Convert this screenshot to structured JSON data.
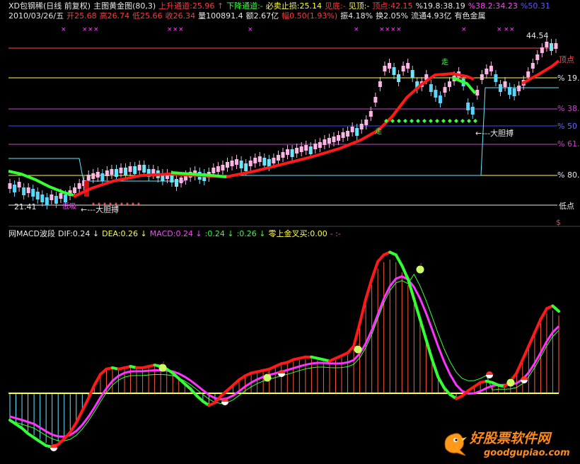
{
  "header": {
    "line1": [
      {
        "text": "XD包钢稀(日线 前复权)",
        "color": "#e8e8e8"
      },
      {
        "text": "主图黄金图(80,3)",
        "color": "#e8e8e8"
      },
      {
        "text": "上升通道:25.96 ↑",
        "color": "#ff3a3a"
      },
      {
        "text": "下降通道:-",
        "color": "#3aff3a"
      },
      {
        "text": "必卖止损:25.14",
        "color": "#ffff44"
      },
      {
        "text": "见底:-",
        "color": "#ff3a3a"
      },
      {
        "text": "见顶:-",
        "color": "#ffff44"
      },
      {
        "text": "顶点:42.15",
        "color": "#ff3a3a"
      },
      {
        "text": "%19.8:38.19",
        "color": "#e8e8e8"
      },
      {
        "text": "%38.2:34.23",
        "color": "#ff44ff"
      },
      {
        "text": "%50.31",
        "color": "#5a5aff"
      }
    ],
    "line2": [
      {
        "text": "2010/03/26/五",
        "color": "#e8e8e8"
      },
      {
        "text": "开25.68",
        "color": "#ff3a3a"
      },
      {
        "text": "高26.74",
        "color": "#ff3a3a"
      },
      {
        "text": "低25.66",
        "color": "#ff3a3a"
      },
      {
        "text": "收26.34",
        "color": "#ff3a3a"
      },
      {
        "text": "量100891.4",
        "color": "#e8e8e8"
      },
      {
        "text": "额2.67亿",
        "color": "#e8e8e8"
      },
      {
        "text": "幅0.50(1.93%)",
        "color": "#ff3a3a"
      },
      {
        "text": "振4.18%",
        "color": "#e8e8e8"
      },
      {
        "text": "换2.05%",
        "color": "#e8e8e8"
      },
      {
        "text": "流通4.93亿",
        "color": "#e8e8e8"
      },
      {
        "text": "有色金属",
        "color": "#e8e8e8"
      }
    ]
  },
  "levels": {
    "top_label": "顶点",
    "l19": "% 19.",
    "l38": "% 38.",
    "l50": "% 50",
    "l61": "% 61.",
    "l80": "% 80.",
    "bottom_label": "低点",
    "dollar": "$"
  },
  "annotations": {
    "high_value": "44.54",
    "low_value": "21.41",
    "bold_buy_1": "←---大胆搏",
    "bold_buy_2": "←---大胆搏",
    "bottom_mark": "低吸",
    "mid_mark_1": "走",
    "mid_mark_2": "走"
  },
  "indicator": {
    "parts": [
      {
        "text": "网MACD波段",
        "color": "#e8e8e8"
      },
      {
        "text": "DIF:0.24 ↓",
        "color": "#e8e8e8"
      },
      {
        "text": "DEA:0.26 ↓",
        "color": "#ffff44"
      },
      {
        "text": "MACD:0.24 ↓",
        "color": "#ff44ff"
      },
      {
        "text": ":0.24 ↓",
        "color": "#3aff3a"
      },
      {
        "text": ":0.26 ↓",
        "color": "#3aff3a"
      },
      {
        "text": "零上金叉买:0.00",
        "color": "#ffff44"
      },
      {
        "text": "- :-",
        "color": "#ff44ff"
      }
    ]
  },
  "watermark": {
    "name": "好股票软件网",
    "url": "goodgupiao.com"
  },
  "colors": {
    "up_candle": "#ffb6e6",
    "down_candle": "#66e8ff",
    "cyan_candle": "#55d8ff",
    "up_channel": "#ff1a1a",
    "down_channel": "#33ff33",
    "top_line": "#ff4a4a",
    "l19_line": "#ffff44",
    "l38_line": "#cc44cc",
    "l50_line": "#4444ff",
    "l61_line": "#cc44cc",
    "l80_line": "#ffff44",
    "bottom_line": "#e8e8e8",
    "dea_line": "#ff33ff",
    "zero_line": "#ffff44"
  }
}
